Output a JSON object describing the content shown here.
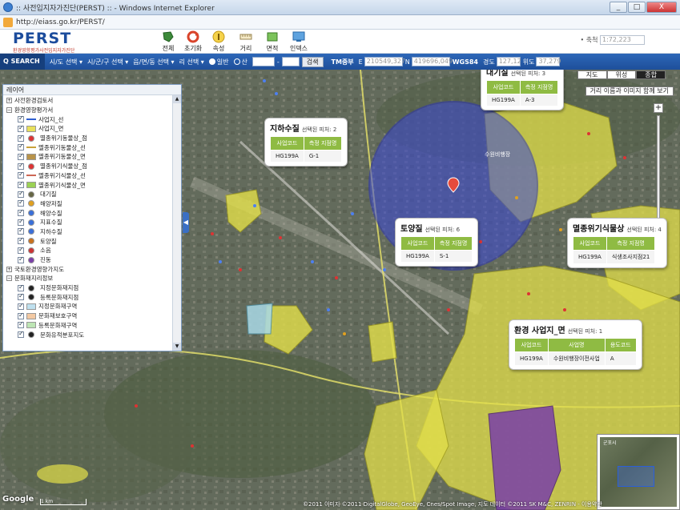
{
  "browser": {
    "title": ":: 사전입지자가진단(PERST) :: - Windows Internet Explorer",
    "url": "http://eiass.go.kr/PERST/",
    "min_label": "_",
    "max_label": "□",
    "close_label": "X"
  },
  "header": {
    "logo": "PERST",
    "logo_sub": "환경영향평가사전입지자가진단",
    "tools": [
      {
        "label": "전체",
        "icon": "globe-icon"
      },
      {
        "label": "초기화",
        "icon": "refresh-icon"
      },
      {
        "label": "속성",
        "icon": "info-icon"
      },
      {
        "label": "거리",
        "icon": "ruler-icon"
      },
      {
        "label": "면적",
        "icon": "area-icon"
      },
      {
        "label": "인덱스",
        "icon": "index-icon"
      }
    ],
    "scale_label": "• 축척",
    "scale_value": "1:72,223"
  },
  "searchbar": {
    "search": "Q SEARCH",
    "sido": "시/도 선택 ▾",
    "sigungu": "시/군/구 선택 ▾",
    "eupmyeon": "읍/면/동 선택 ▾",
    "ri": "리 선택 ▾",
    "general": "일반",
    "mountain": "산",
    "go": "검색",
    "tm_label": "TM중부",
    "e_label": "E",
    "e_value": "210549,327",
    "n_label": "N",
    "n_value": "419696,049",
    "wgs_label": "WGS84",
    "lon_label": "경도",
    "lon_value": "127,12",
    "lat_label": "위도",
    "lat_value": "37,279"
  },
  "map": {
    "tabs": [
      "지도",
      "위성",
      "종합"
    ],
    "active_tab": "종합",
    "label_toggle": "거리 이름과 이미지 함께 보기",
    "copyright": "©2011 이미지 ©2011 DigitalGlobe, GeoEye, Cnes/Spot Image, 지도 데이터 ©2011 SK M&C, ZENRIN - 이용약관",
    "google": "Google",
    "scale_top": "1 km",
    "minimap_label": "군포시"
  },
  "layer_panel": {
    "title": "레이어",
    "rows": [
      {
        "text": "사전환경검토서",
        "type": "group",
        "expanded": false,
        "indent": 0
      },
      {
        "text": "환경영향평가서",
        "type": "group",
        "expanded": true,
        "indent": 0
      },
      {
        "text": "사업지_선",
        "type": "layer",
        "swatch": "#2f5fd0",
        "indent": 1,
        "sw_kind": "line"
      },
      {
        "text": "사업지_면",
        "type": "layer",
        "swatch": "#e8e05a",
        "indent": 1,
        "sw_kind": "fill"
      },
      {
        "text": "멸종위기동물상_점",
        "type": "layer",
        "swatch": "#d33",
        "indent": 1,
        "sw_kind": "dot"
      },
      {
        "text": "멸종위기동물상_선",
        "type": "layer",
        "swatch": "#c9a23a",
        "indent": 1,
        "sw_kind": "line"
      },
      {
        "text": "멸종위기동물상_면",
        "type": "layer",
        "swatch": "#b8934a",
        "indent": 1,
        "sw_kind": "fill"
      },
      {
        "text": "멸종위기식물상_점",
        "type": "layer",
        "swatch": "#d33",
        "indent": 1,
        "sw_kind": "dot"
      },
      {
        "text": "멸종위기식물상_선",
        "type": "layer",
        "swatch": "#c65",
        "indent": 1,
        "sw_kind": "line"
      },
      {
        "text": "멸종위기식물상_면",
        "type": "layer",
        "swatch": "#9bd154",
        "indent": 1,
        "sw_kind": "fill"
      },
      {
        "text": "대기질",
        "type": "layer",
        "swatch": "#664",
        "indent": 1,
        "sw_kind": "dot"
      },
      {
        "text": "해양저질",
        "type": "layer",
        "swatch": "#e0a020",
        "indent": 1,
        "sw_kind": "dot"
      },
      {
        "text": "해양수질",
        "type": "layer",
        "swatch": "#3a6fd9",
        "indent": 1,
        "sw_kind": "dot"
      },
      {
        "text": "지표수질",
        "type": "layer",
        "swatch": "#3a6fd9",
        "indent": 1,
        "sw_kind": "dot"
      },
      {
        "text": "지하수질",
        "type": "layer",
        "swatch": "#3a6fd9",
        "indent": 1,
        "sw_kind": "dot"
      },
      {
        "text": "토양질",
        "type": "layer",
        "swatch": "#c9721e",
        "indent": 1,
        "sw_kind": "dot"
      },
      {
        "text": "소음",
        "type": "layer",
        "swatch": "#c33",
        "indent": 1,
        "sw_kind": "dot"
      },
      {
        "text": "진동",
        "type": "layer",
        "swatch": "#7a3fa8",
        "indent": 1,
        "sw_kind": "dot"
      },
      {
        "text": "국토환경영향가지도",
        "type": "group",
        "expanded": false,
        "indent": 0
      },
      {
        "text": "문화재지리정보",
        "type": "group",
        "expanded": true,
        "indent": 0
      },
      {
        "text": "지정문화재지점",
        "type": "layer",
        "swatch": "#222",
        "indent": 1,
        "sw_kind": "dot"
      },
      {
        "text": "등록문화재지점",
        "type": "layer",
        "swatch": "#222",
        "indent": 1,
        "sw_kind": "dot"
      },
      {
        "text": "지정문화재구역",
        "type": "layer",
        "swatch": "#bfe0ee",
        "indent": 1,
        "sw_kind": "fill"
      },
      {
        "text": "문화재보호구역",
        "type": "layer",
        "swatch": "#f3c9a3",
        "indent": 1,
        "sw_kind": "fill"
      },
      {
        "text": "등록문화재구역",
        "type": "layer",
        "swatch": "#bde5b4",
        "indent": 1,
        "sw_kind": "fill"
      },
      {
        "text": "문화유적분포지도",
        "type": "layer",
        "swatch": "#222",
        "indent": 1,
        "sw_kind": "dot"
      }
    ]
  },
  "callouts": {
    "air": {
      "title": "대기질",
      "sub": "선택된 피처: 3",
      "headers": [
        "사업코드",
        "측정 지점명"
      ],
      "cells": [
        "HG199A",
        "A-3"
      ]
    },
    "ground": {
      "title": "지하수질",
      "sub": "선택된 피처: 2",
      "headers": [
        "사업코드",
        "측정 지점명"
      ],
      "cells": [
        "HG199A",
        "G-1"
      ]
    },
    "soil": {
      "title": "토양질",
      "sub": "선택된 피처: 6",
      "headers": [
        "사업코드",
        "측정 지점명"
      ],
      "cells": [
        "HG199A",
        "S-1"
      ]
    },
    "plant": {
      "title": "멸종위기식물상",
      "sub": "선택된 피처: 4",
      "headers": [
        "사업코드",
        "측정 지점명"
      ],
      "cells": [
        "HG199A",
        "식생조사지점21"
      ]
    },
    "site": {
      "title": "환경 사업지_면",
      "sub": "선택된 피처: 1",
      "headers": [
        "사업코드",
        "사업명",
        "용도코드"
      ],
      "cells": [
        "HG199A",
        "수원비행장이전사업",
        "A"
      ]
    }
  },
  "colors": {
    "accent": "#1e4f9a",
    "site_fill": "#e3e04a",
    "circle_fill": "#3b48d8"
  }
}
